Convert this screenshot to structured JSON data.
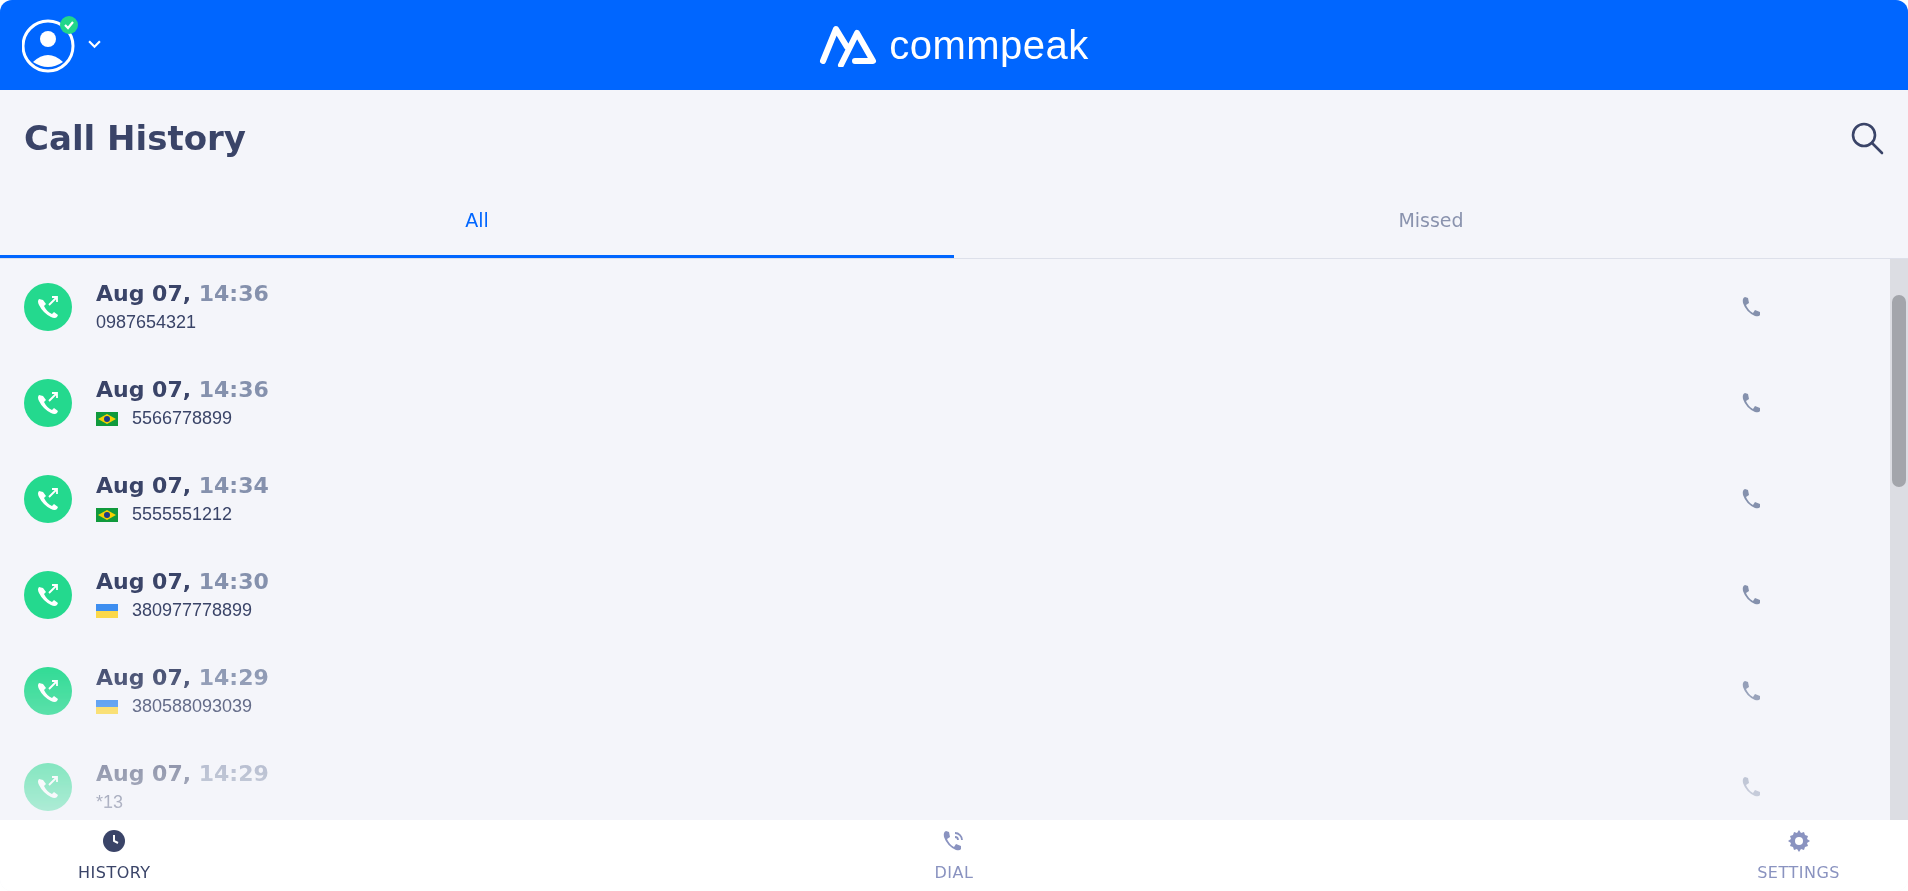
{
  "header": {
    "logo_text": "commpeak",
    "status_online": true
  },
  "page": {
    "title": "Call History"
  },
  "tabs": [
    {
      "label": "All",
      "selected": true
    },
    {
      "label": "Missed",
      "selected": false
    }
  ],
  "calls": [
    {
      "date": "Aug 07,",
      "time": "14:36",
      "number": "0987654321"
    },
    {
      "date": "Aug 07,",
      "time": "14:36",
      "number": "5566778899",
      "kind": "brazil"
    },
    {
      "date": "Aug 07,",
      "time": "14:34",
      "number": "5555551212",
      "kind": "brazil"
    },
    {
      "date": "Aug 07,",
      "time": "14:30",
      "number": "380977778899",
      "kind": "ukraine"
    },
    {
      "date": "Aug 07,",
      "time": "14:29",
      "number": "380588093039",
      "kind": "ukraine"
    },
    {
      "date": "Aug 07,",
      "time": "14:29",
      "number": "*13"
    }
  ],
  "nav": [
    {
      "label": "HISTORY",
      "kind": "history",
      "selected": true
    },
    {
      "label": "DIAL",
      "kind": "dial",
      "selected": false
    },
    {
      "label": "SETTINGS",
      "kind": "settings",
      "selected": false
    }
  ]
}
